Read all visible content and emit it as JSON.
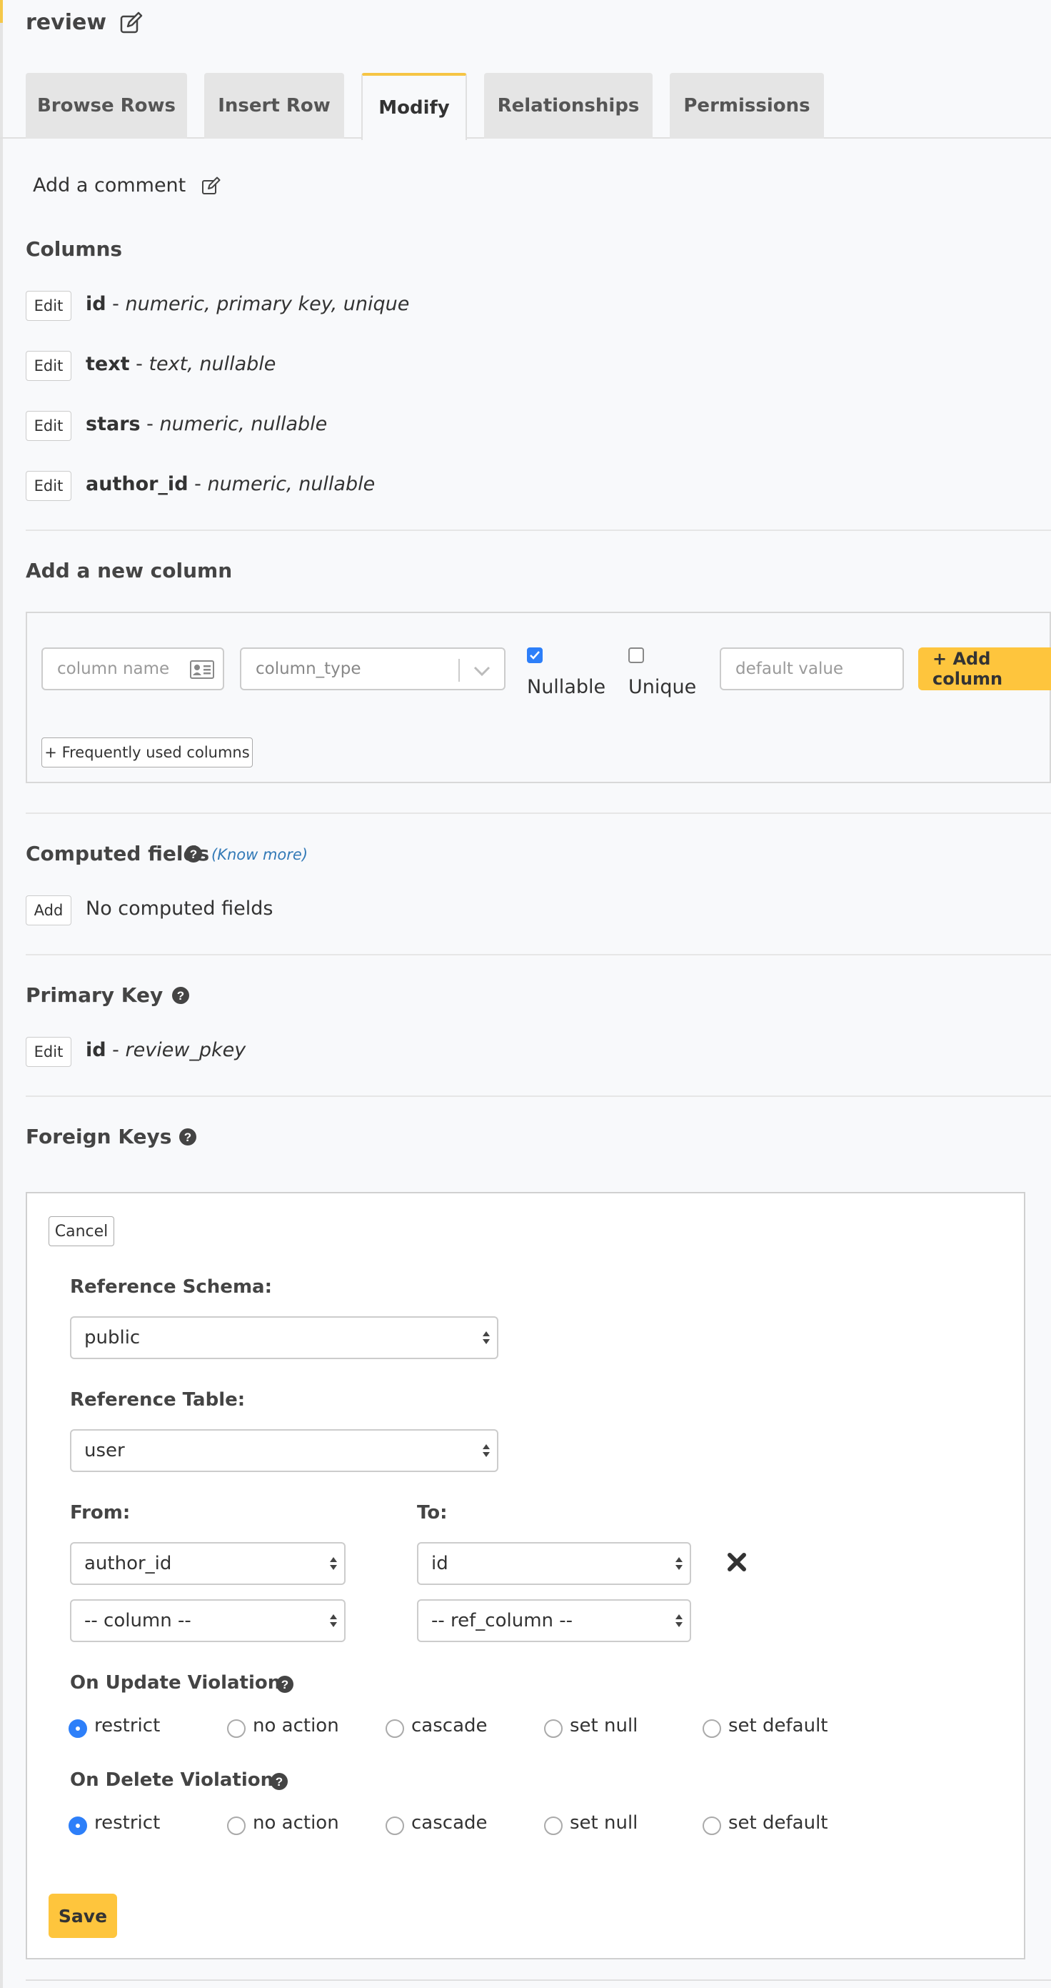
{
  "page": {
    "title": "review"
  },
  "tabs": [
    {
      "label": "Browse Rows",
      "active": false
    },
    {
      "label": "Insert Row",
      "active": false
    },
    {
      "label": "Modify",
      "active": true
    },
    {
      "label": "Relationships",
      "active": false
    },
    {
      "label": "Permissions",
      "active": false
    }
  ],
  "comment": {
    "label": "Add a comment"
  },
  "columns": {
    "heading": "Columns",
    "edit_label": "Edit",
    "separator": " - ",
    "items": [
      {
        "name": "id",
        "desc": "numeric, primary key, unique"
      },
      {
        "name": "text",
        "desc": "text, nullable"
      },
      {
        "name": "stars",
        "desc": "numeric, nullable"
      },
      {
        "name": "author_id",
        "desc": "numeric, nullable"
      }
    ]
  },
  "new_column": {
    "heading": "Add a new column",
    "name_placeholder": "column name",
    "type_placeholder": "column_type",
    "nullable_label": "Nullable",
    "nullable_checked": true,
    "unique_label": "Unique",
    "unique_checked": false,
    "default_placeholder": "default value",
    "add_button": "+ Add column",
    "frequent_button": "+ Frequently used columns"
  },
  "computed_fields": {
    "heading": "Computed fields",
    "know_more": "(Know more)",
    "add_label": "Add",
    "empty_text": "No computed fields"
  },
  "primary_key": {
    "heading": "Primary Key",
    "edit_label": "Edit",
    "column": "id",
    "separator": " - ",
    "constraint": "review_pkey"
  },
  "foreign_keys": {
    "heading": "Foreign Keys",
    "cancel_label": "Cancel",
    "ref_schema_label": "Reference Schema:",
    "ref_schema_value": "public",
    "ref_table_label": "Reference Table:",
    "ref_table_value": "user",
    "from_label": "From:",
    "to_label": "To:",
    "mappings": [
      {
        "from": "author_id",
        "to": "id"
      },
      {
        "from": "-- column --",
        "to": "-- ref_column --"
      }
    ],
    "on_update_label": "On Update Violation:",
    "on_delete_label": "On Delete Violation:",
    "options": [
      "restrict",
      "no action",
      "cascade",
      "set null",
      "set default"
    ],
    "on_update_selected": "restrict",
    "on_delete_selected": "restrict",
    "save_label": "Save"
  },
  "colors": {
    "accent": "#fec53d",
    "link": "#337ab7",
    "check": "#2d7ff9"
  }
}
